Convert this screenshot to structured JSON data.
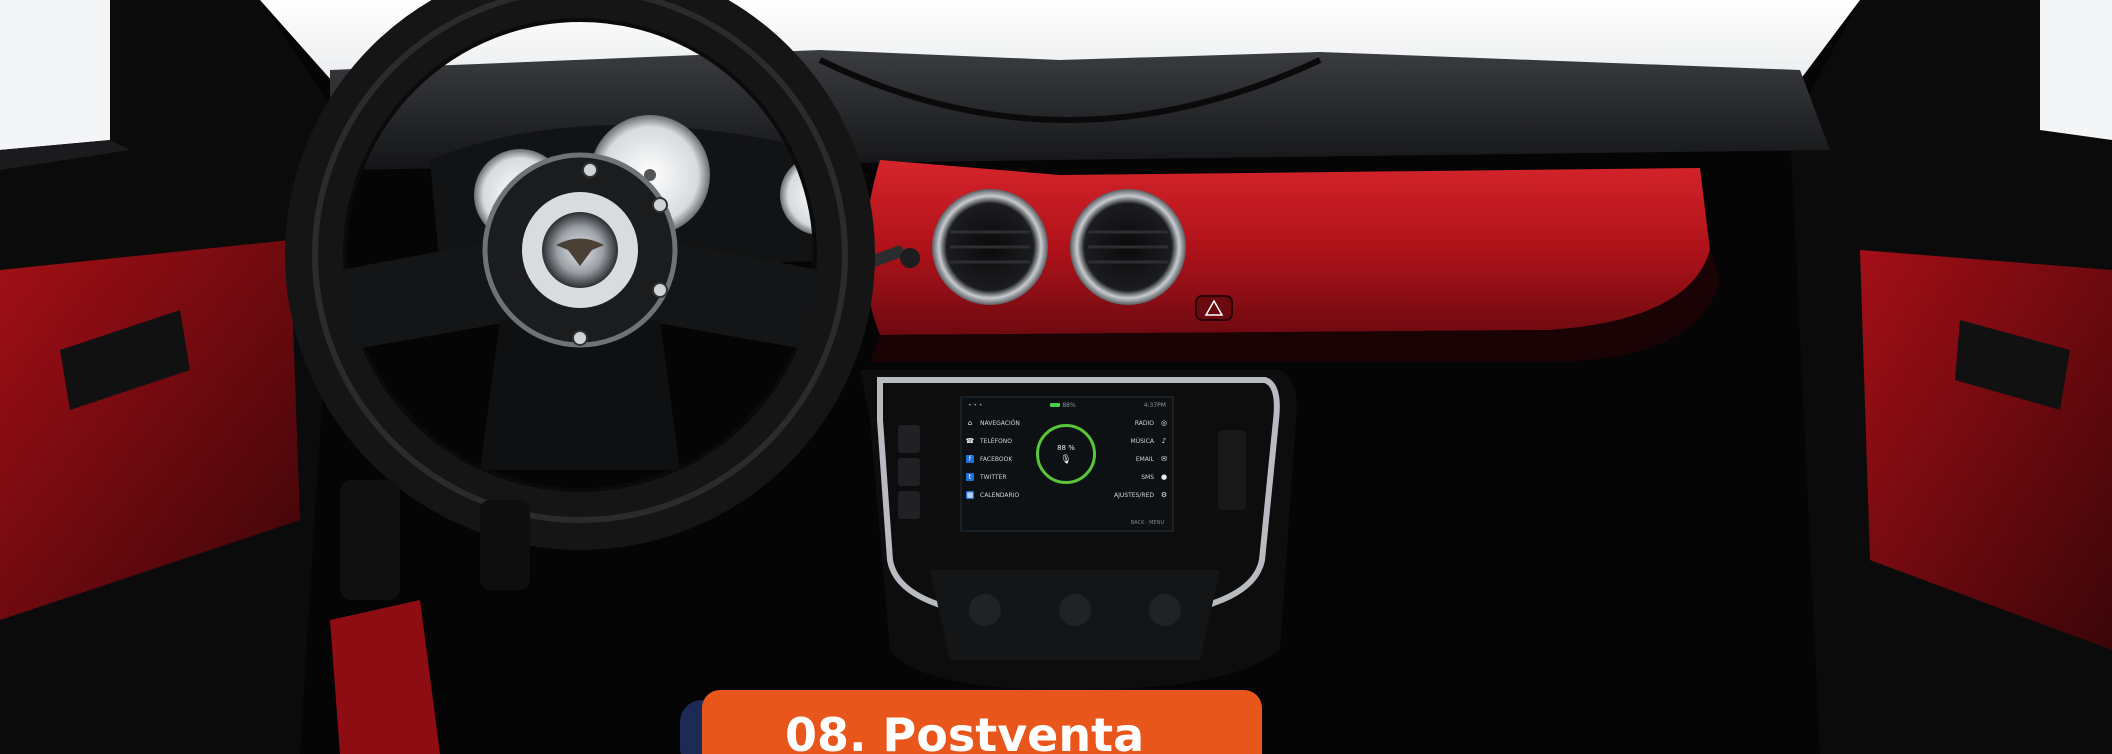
{
  "infotainment": {
    "status_left": "• • •",
    "status_center": "88%",
    "status_right": "4:37PM",
    "left_menu": [
      {
        "icon": "navigation-icon",
        "label": "NAVEGACIÓN"
      },
      {
        "icon": "phone-icon",
        "label": "TELÉFONO"
      },
      {
        "icon": "facebook-icon",
        "label": "FACEBOOK"
      },
      {
        "icon": "twitter-icon",
        "label": "TWITTER"
      },
      {
        "icon": "calendar-icon",
        "label": "CALENDARIO"
      }
    ],
    "right_menu": [
      {
        "icon": "radio-icon",
        "label": "RADIO"
      },
      {
        "icon": "music-icon",
        "label": "MÚSICA"
      },
      {
        "icon": "email-icon",
        "label": "EMAIL"
      },
      {
        "icon": "sms-icon",
        "label": "SMS"
      },
      {
        "icon": "settings-icon",
        "label": "AJUSTES/RED"
      }
    ],
    "center_value": "88 %",
    "center_icon": "microphone-icon",
    "footer": "BACK · MENU"
  },
  "section": {
    "title": "08. Postventa"
  },
  "colors": {
    "accent": "#e8561b",
    "dash_red": "#b5121b",
    "ring_green": "#58c53a"
  }
}
